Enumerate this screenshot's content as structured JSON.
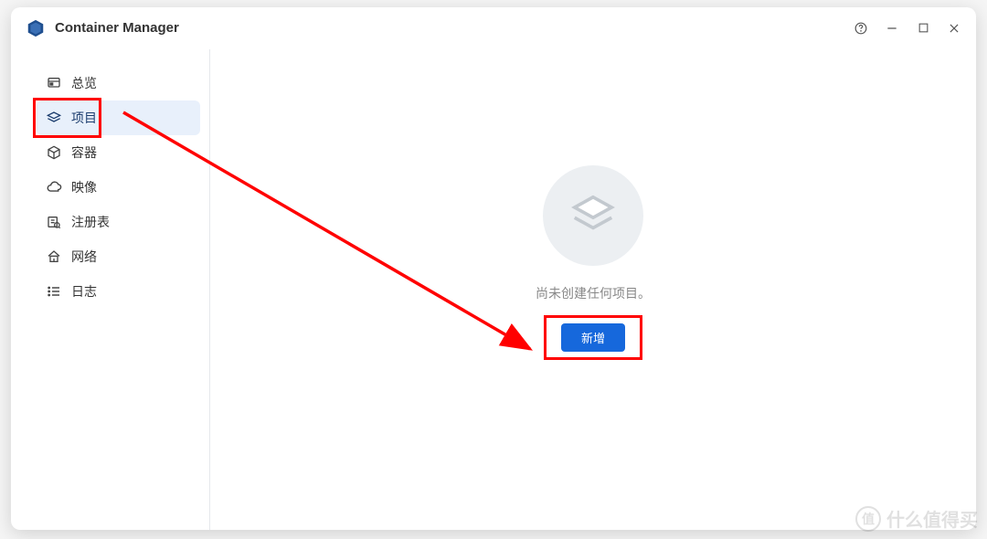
{
  "app": {
    "title": "Container Manager"
  },
  "sidebar": {
    "items": [
      {
        "label": "总览",
        "icon": "dashboard-icon",
        "active": false
      },
      {
        "label": "项目",
        "icon": "layers-icon",
        "active": true
      },
      {
        "label": "容器",
        "icon": "cube-icon",
        "active": false
      },
      {
        "label": "映像",
        "icon": "cloud-icon",
        "active": false
      },
      {
        "label": "注册表",
        "icon": "registry-icon",
        "active": false
      },
      {
        "label": "网络",
        "icon": "network-icon",
        "active": false
      },
      {
        "label": "日志",
        "icon": "log-icon",
        "active": false
      }
    ]
  },
  "main": {
    "empty_message": "尚未创建任何项目。",
    "new_button_label": "新增"
  },
  "annotation": {
    "highlight_color": "#ff0000",
    "arrow_color": "#ff0000"
  },
  "watermark": {
    "badge_text": "值",
    "text": "什么值得买"
  }
}
